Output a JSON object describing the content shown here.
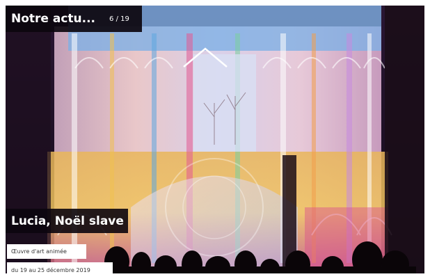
{
  "header": {
    "title": "Notre actu...",
    "counter": "6 / 19"
  },
  "slide": {
    "title": "Lucia, Noël slave",
    "type_label": "Œuvre d'art animée",
    "date_label": "du 19 au 25 décembre 2019"
  },
  "icons": {
    "up_chevron": "chevron-up-icon"
  },
  "colors": {
    "overlay_dark": "#0c060e",
    "text_light": "#ffffff",
    "tag_bg": "#ffffff",
    "tag_text": "#333333"
  }
}
